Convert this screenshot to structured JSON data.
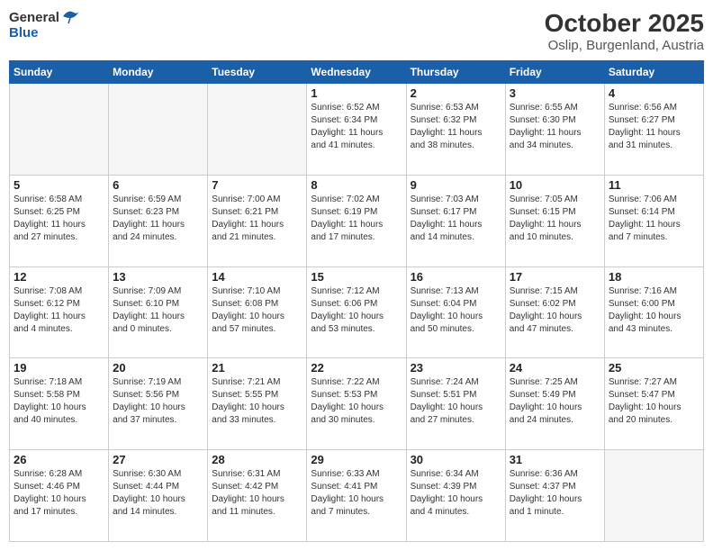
{
  "header": {
    "logo_general": "General",
    "logo_blue": "Blue",
    "month": "October 2025",
    "location": "Oslip, Burgenland, Austria"
  },
  "weekdays": [
    "Sunday",
    "Monday",
    "Tuesday",
    "Wednesday",
    "Thursday",
    "Friday",
    "Saturday"
  ],
  "weeks": [
    [
      {
        "day": "",
        "info": ""
      },
      {
        "day": "",
        "info": ""
      },
      {
        "day": "",
        "info": ""
      },
      {
        "day": "1",
        "info": "Sunrise: 6:52 AM\nSunset: 6:34 PM\nDaylight: 11 hours\nand 41 minutes."
      },
      {
        "day": "2",
        "info": "Sunrise: 6:53 AM\nSunset: 6:32 PM\nDaylight: 11 hours\nand 38 minutes."
      },
      {
        "day": "3",
        "info": "Sunrise: 6:55 AM\nSunset: 6:30 PM\nDaylight: 11 hours\nand 34 minutes."
      },
      {
        "day": "4",
        "info": "Sunrise: 6:56 AM\nSunset: 6:27 PM\nDaylight: 11 hours\nand 31 minutes."
      }
    ],
    [
      {
        "day": "5",
        "info": "Sunrise: 6:58 AM\nSunset: 6:25 PM\nDaylight: 11 hours\nand 27 minutes."
      },
      {
        "day": "6",
        "info": "Sunrise: 6:59 AM\nSunset: 6:23 PM\nDaylight: 11 hours\nand 24 minutes."
      },
      {
        "day": "7",
        "info": "Sunrise: 7:00 AM\nSunset: 6:21 PM\nDaylight: 11 hours\nand 21 minutes."
      },
      {
        "day": "8",
        "info": "Sunrise: 7:02 AM\nSunset: 6:19 PM\nDaylight: 11 hours\nand 17 minutes."
      },
      {
        "day": "9",
        "info": "Sunrise: 7:03 AM\nSunset: 6:17 PM\nDaylight: 11 hours\nand 14 minutes."
      },
      {
        "day": "10",
        "info": "Sunrise: 7:05 AM\nSunset: 6:15 PM\nDaylight: 11 hours\nand 10 minutes."
      },
      {
        "day": "11",
        "info": "Sunrise: 7:06 AM\nSunset: 6:14 PM\nDaylight: 11 hours\nand 7 minutes."
      }
    ],
    [
      {
        "day": "12",
        "info": "Sunrise: 7:08 AM\nSunset: 6:12 PM\nDaylight: 11 hours\nand 4 minutes."
      },
      {
        "day": "13",
        "info": "Sunrise: 7:09 AM\nSunset: 6:10 PM\nDaylight: 11 hours\nand 0 minutes."
      },
      {
        "day": "14",
        "info": "Sunrise: 7:10 AM\nSunset: 6:08 PM\nDaylight: 10 hours\nand 57 minutes."
      },
      {
        "day": "15",
        "info": "Sunrise: 7:12 AM\nSunset: 6:06 PM\nDaylight: 10 hours\nand 53 minutes."
      },
      {
        "day": "16",
        "info": "Sunrise: 7:13 AM\nSunset: 6:04 PM\nDaylight: 10 hours\nand 50 minutes."
      },
      {
        "day": "17",
        "info": "Sunrise: 7:15 AM\nSunset: 6:02 PM\nDaylight: 10 hours\nand 47 minutes."
      },
      {
        "day": "18",
        "info": "Sunrise: 7:16 AM\nSunset: 6:00 PM\nDaylight: 10 hours\nand 43 minutes."
      }
    ],
    [
      {
        "day": "19",
        "info": "Sunrise: 7:18 AM\nSunset: 5:58 PM\nDaylight: 10 hours\nand 40 minutes."
      },
      {
        "day": "20",
        "info": "Sunrise: 7:19 AM\nSunset: 5:56 PM\nDaylight: 10 hours\nand 37 minutes."
      },
      {
        "day": "21",
        "info": "Sunrise: 7:21 AM\nSunset: 5:55 PM\nDaylight: 10 hours\nand 33 minutes."
      },
      {
        "day": "22",
        "info": "Sunrise: 7:22 AM\nSunset: 5:53 PM\nDaylight: 10 hours\nand 30 minutes."
      },
      {
        "day": "23",
        "info": "Sunrise: 7:24 AM\nSunset: 5:51 PM\nDaylight: 10 hours\nand 27 minutes."
      },
      {
        "day": "24",
        "info": "Sunrise: 7:25 AM\nSunset: 5:49 PM\nDaylight: 10 hours\nand 24 minutes."
      },
      {
        "day": "25",
        "info": "Sunrise: 7:27 AM\nSunset: 5:47 PM\nDaylight: 10 hours\nand 20 minutes."
      }
    ],
    [
      {
        "day": "26",
        "info": "Sunrise: 6:28 AM\nSunset: 4:46 PM\nDaylight: 10 hours\nand 17 minutes."
      },
      {
        "day": "27",
        "info": "Sunrise: 6:30 AM\nSunset: 4:44 PM\nDaylight: 10 hours\nand 14 minutes."
      },
      {
        "day": "28",
        "info": "Sunrise: 6:31 AM\nSunset: 4:42 PM\nDaylight: 10 hours\nand 11 minutes."
      },
      {
        "day": "29",
        "info": "Sunrise: 6:33 AM\nSunset: 4:41 PM\nDaylight: 10 hours\nand 7 minutes."
      },
      {
        "day": "30",
        "info": "Sunrise: 6:34 AM\nSunset: 4:39 PM\nDaylight: 10 hours\nand 4 minutes."
      },
      {
        "day": "31",
        "info": "Sunrise: 6:36 AM\nSunset: 4:37 PM\nDaylight: 10 hours\nand 1 minute."
      },
      {
        "day": "",
        "info": ""
      }
    ]
  ]
}
